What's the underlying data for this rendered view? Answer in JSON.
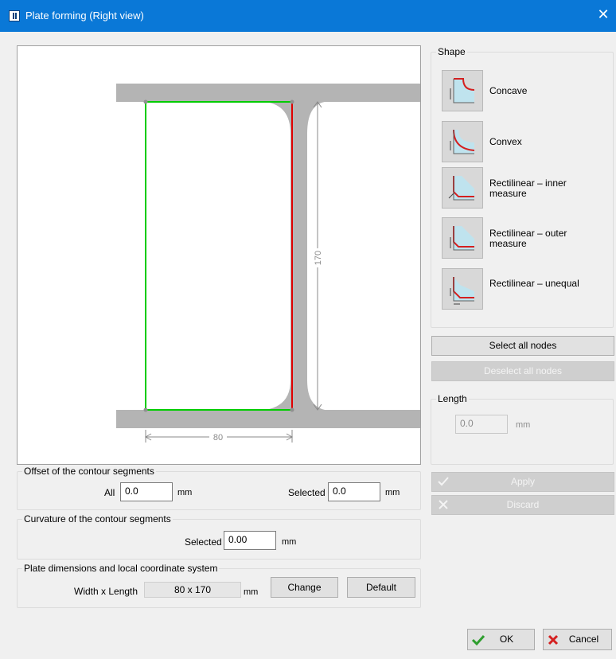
{
  "window": {
    "title": "Plate forming (Right view)",
    "close_glyph": "✕"
  },
  "drawing": {
    "dimension_height": "170",
    "dimension_width": "80"
  },
  "shape": {
    "legend": "Shape",
    "options": [
      {
        "label": "Concave"
      },
      {
        "label": "Convex"
      },
      {
        "label": "Rectilinear – inner measure"
      },
      {
        "label": "Rectilinear – outer measure"
      },
      {
        "label": "Rectilinear – unequal"
      }
    ]
  },
  "nodes": {
    "select_all": "Select all nodes",
    "deselect_all": "Deselect all nodes"
  },
  "length": {
    "legend": "Length",
    "value": "0.0",
    "unit": "mm"
  },
  "actions": {
    "apply": "Apply",
    "discard": "Discard"
  },
  "offset": {
    "legend": "Offset of the contour segments",
    "all_label": "All",
    "all_value": "0.0",
    "all_unit": "mm",
    "selected_label": "Selected",
    "selected_value": "0.0",
    "selected_unit": "mm"
  },
  "curvature": {
    "legend": "Curvature of the contour segments",
    "selected_label": "Selected",
    "selected_value": "0.00",
    "unit": "mm"
  },
  "plate": {
    "legend": "Plate dimensions and local coordinate system",
    "wl_label": "Width x Length",
    "wl_value": "80 x 170",
    "unit": "mm",
    "change": "Change",
    "default": "Default"
  },
  "footer": {
    "ok": "OK",
    "cancel": "Cancel"
  },
  "colors": {
    "title_bar": "#0a78d7",
    "plate_outline": "#00cc00",
    "selected_edge": "#e00000",
    "profile_gray": "#b4b4b4",
    "ok_check": "#2e9e2e",
    "cancel_x": "#d42020"
  }
}
